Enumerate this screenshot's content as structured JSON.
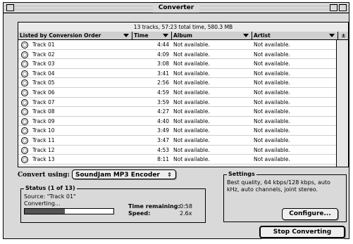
{
  "window": {
    "title": "Converter"
  },
  "list": {
    "summary": "13 tracks, 57:23 total time, 580.3 MB",
    "columns": [
      "Listed by Conversion Order",
      "Time",
      "Album",
      "Artist"
    ],
    "tracks": [
      {
        "name": "Track 01",
        "time": "4:44",
        "album": "Not available.",
        "artist": "Not available."
      },
      {
        "name": "Track 02",
        "time": "4:09",
        "album": "Not available.",
        "artist": "Not available."
      },
      {
        "name": "Track 03",
        "time": "3:08",
        "album": "Not available.",
        "artist": "Not available."
      },
      {
        "name": "Track 04",
        "time": "3:41",
        "album": "Not available.",
        "artist": "Not available."
      },
      {
        "name": "Track 05",
        "time": "2:56",
        "album": "Not available.",
        "artist": "Not available."
      },
      {
        "name": "Track 06",
        "time": "4:59",
        "album": "Not available.",
        "artist": "Not available."
      },
      {
        "name": "Track 07",
        "time": "3:59",
        "album": "Not available.",
        "artist": "Not available."
      },
      {
        "name": "Track 08",
        "time": "4:27",
        "album": "Not available.",
        "artist": "Not available."
      },
      {
        "name": "Track 09",
        "time": "4:40",
        "album": "Not available.",
        "artist": "Not available."
      },
      {
        "name": "Track 10",
        "time": "3:49",
        "album": "Not available.",
        "artist": "Not available."
      },
      {
        "name": "Track 11",
        "time": "3:47",
        "album": "Not available.",
        "artist": "Not available."
      },
      {
        "name": "Track 12",
        "time": "4:53",
        "album": "Not available.",
        "artist": "Not available."
      },
      {
        "name": "Track 13",
        "time": "8:11",
        "album": "Not available.",
        "artist": "Not available."
      }
    ]
  },
  "convert": {
    "label": "Convert using:",
    "encoder": "SoundJam MP3 Encoder"
  },
  "status": {
    "group_label": "Status (1 of 13)",
    "source": "Source: \"Track 01\"",
    "state": "Converting...",
    "progress": 0.45,
    "time_remaining_label": "Time remaining:",
    "time_remaining": "0:58",
    "speed_label": "Speed:",
    "speed": "2.6x"
  },
  "settings": {
    "group_label": "Settings",
    "text": "Best quality, 64 kbps/128 kbps, auto kHz, auto channels, joint stereo.",
    "configure_label": "Configure..."
  },
  "actions": {
    "stop_label": "Stop Converting"
  },
  "icons": {
    "track": "cd-icon",
    "sort": "sort-triangle-icon",
    "popup": "popup-arrows-icon"
  }
}
